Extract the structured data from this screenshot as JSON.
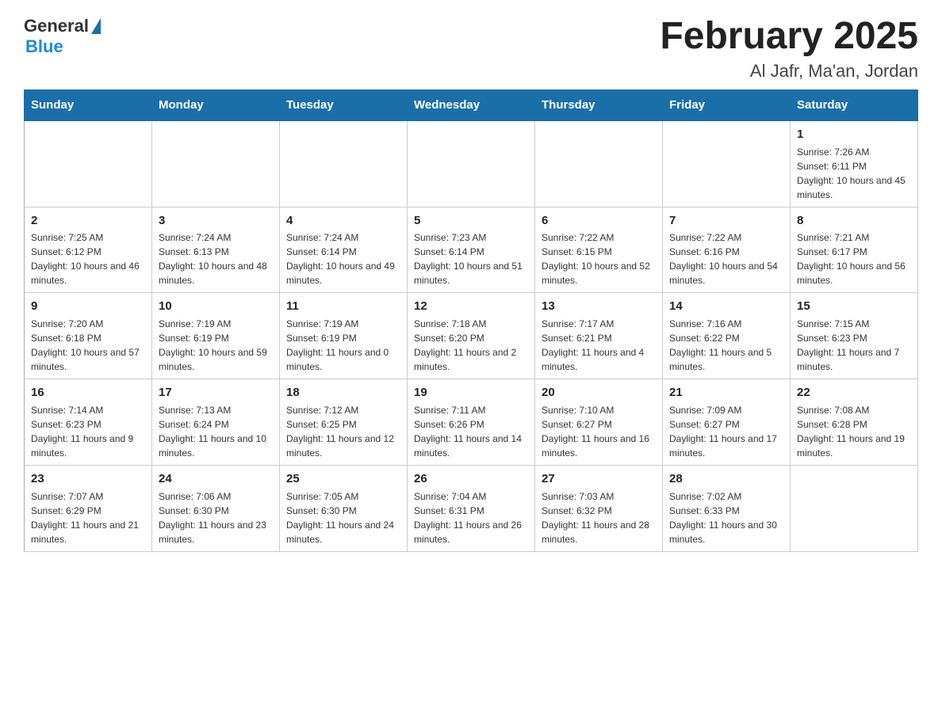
{
  "header": {
    "logo_general": "General",
    "logo_blue": "Blue",
    "title": "February 2025",
    "subtitle": "Al Jafr, Ma'an, Jordan"
  },
  "weekdays": [
    "Sunday",
    "Monday",
    "Tuesday",
    "Wednesday",
    "Thursday",
    "Friday",
    "Saturday"
  ],
  "weeks": [
    [
      {
        "day": "",
        "info": ""
      },
      {
        "day": "",
        "info": ""
      },
      {
        "day": "",
        "info": ""
      },
      {
        "day": "",
        "info": ""
      },
      {
        "day": "",
        "info": ""
      },
      {
        "day": "",
        "info": ""
      },
      {
        "day": "1",
        "info": "Sunrise: 7:26 AM\nSunset: 6:11 PM\nDaylight: 10 hours and 45 minutes."
      }
    ],
    [
      {
        "day": "2",
        "info": "Sunrise: 7:25 AM\nSunset: 6:12 PM\nDaylight: 10 hours and 46 minutes."
      },
      {
        "day": "3",
        "info": "Sunrise: 7:24 AM\nSunset: 6:13 PM\nDaylight: 10 hours and 48 minutes."
      },
      {
        "day": "4",
        "info": "Sunrise: 7:24 AM\nSunset: 6:14 PM\nDaylight: 10 hours and 49 minutes."
      },
      {
        "day": "5",
        "info": "Sunrise: 7:23 AM\nSunset: 6:14 PM\nDaylight: 10 hours and 51 minutes."
      },
      {
        "day": "6",
        "info": "Sunrise: 7:22 AM\nSunset: 6:15 PM\nDaylight: 10 hours and 52 minutes."
      },
      {
        "day": "7",
        "info": "Sunrise: 7:22 AM\nSunset: 6:16 PM\nDaylight: 10 hours and 54 minutes."
      },
      {
        "day": "8",
        "info": "Sunrise: 7:21 AM\nSunset: 6:17 PM\nDaylight: 10 hours and 56 minutes."
      }
    ],
    [
      {
        "day": "9",
        "info": "Sunrise: 7:20 AM\nSunset: 6:18 PM\nDaylight: 10 hours and 57 minutes."
      },
      {
        "day": "10",
        "info": "Sunrise: 7:19 AM\nSunset: 6:19 PM\nDaylight: 10 hours and 59 minutes."
      },
      {
        "day": "11",
        "info": "Sunrise: 7:19 AM\nSunset: 6:19 PM\nDaylight: 11 hours and 0 minutes."
      },
      {
        "day": "12",
        "info": "Sunrise: 7:18 AM\nSunset: 6:20 PM\nDaylight: 11 hours and 2 minutes."
      },
      {
        "day": "13",
        "info": "Sunrise: 7:17 AM\nSunset: 6:21 PM\nDaylight: 11 hours and 4 minutes."
      },
      {
        "day": "14",
        "info": "Sunrise: 7:16 AM\nSunset: 6:22 PM\nDaylight: 11 hours and 5 minutes."
      },
      {
        "day": "15",
        "info": "Sunrise: 7:15 AM\nSunset: 6:23 PM\nDaylight: 11 hours and 7 minutes."
      }
    ],
    [
      {
        "day": "16",
        "info": "Sunrise: 7:14 AM\nSunset: 6:23 PM\nDaylight: 11 hours and 9 minutes."
      },
      {
        "day": "17",
        "info": "Sunrise: 7:13 AM\nSunset: 6:24 PM\nDaylight: 11 hours and 10 minutes."
      },
      {
        "day": "18",
        "info": "Sunrise: 7:12 AM\nSunset: 6:25 PM\nDaylight: 11 hours and 12 minutes."
      },
      {
        "day": "19",
        "info": "Sunrise: 7:11 AM\nSunset: 6:26 PM\nDaylight: 11 hours and 14 minutes."
      },
      {
        "day": "20",
        "info": "Sunrise: 7:10 AM\nSunset: 6:27 PM\nDaylight: 11 hours and 16 minutes."
      },
      {
        "day": "21",
        "info": "Sunrise: 7:09 AM\nSunset: 6:27 PM\nDaylight: 11 hours and 17 minutes."
      },
      {
        "day": "22",
        "info": "Sunrise: 7:08 AM\nSunset: 6:28 PM\nDaylight: 11 hours and 19 minutes."
      }
    ],
    [
      {
        "day": "23",
        "info": "Sunrise: 7:07 AM\nSunset: 6:29 PM\nDaylight: 11 hours and 21 minutes."
      },
      {
        "day": "24",
        "info": "Sunrise: 7:06 AM\nSunset: 6:30 PM\nDaylight: 11 hours and 23 minutes."
      },
      {
        "day": "25",
        "info": "Sunrise: 7:05 AM\nSunset: 6:30 PM\nDaylight: 11 hours and 24 minutes."
      },
      {
        "day": "26",
        "info": "Sunrise: 7:04 AM\nSunset: 6:31 PM\nDaylight: 11 hours and 26 minutes."
      },
      {
        "day": "27",
        "info": "Sunrise: 7:03 AM\nSunset: 6:32 PM\nDaylight: 11 hours and 28 minutes."
      },
      {
        "day": "28",
        "info": "Sunrise: 7:02 AM\nSunset: 6:33 PM\nDaylight: 11 hours and 30 minutes."
      },
      {
        "day": "",
        "info": ""
      }
    ]
  ]
}
